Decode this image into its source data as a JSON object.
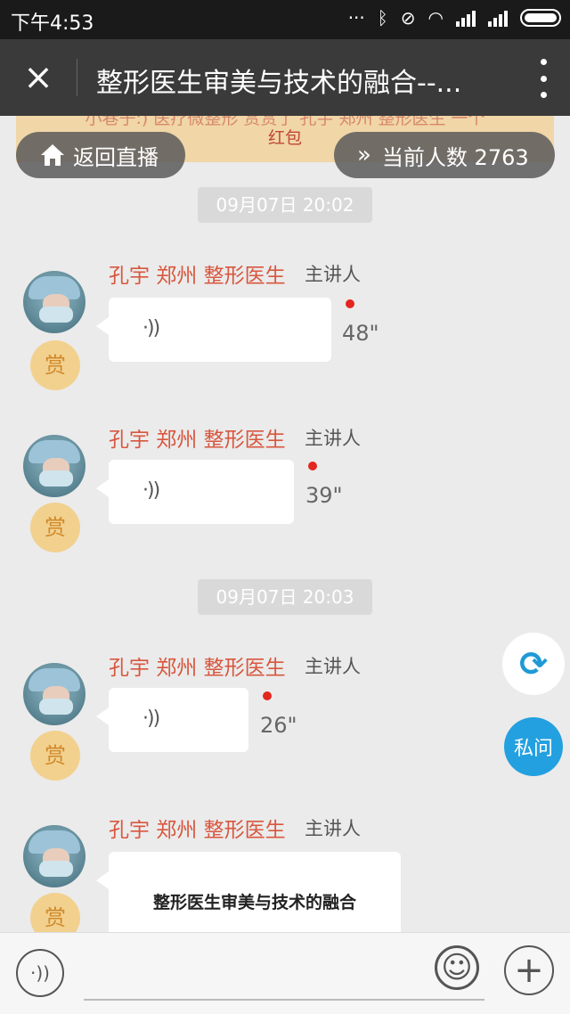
{
  "status_bar": {
    "time": "下午4:53",
    "icons": [
      "more-dots-icon",
      "bluetooth-icon",
      "vibrate-off-icon",
      "wifi-icon",
      "signal-icon",
      "signal-icon",
      "battery-icon"
    ]
  },
  "header": {
    "close_icon": "×",
    "title": "整形医生审美与技术的融合--..."
  },
  "notice": {
    "line1": "小巷子:) 医疗微整形 赏赏了 孔宇 郑州 整形医生 一个",
    "line2": "红包"
  },
  "live": {
    "back_label": "返回直播",
    "online_label": "当前人数 2763"
  },
  "messages": [
    {
      "timestamp": "09月07日 20:02"
    },
    {
      "sender": "孔宇 郑州 整形医生",
      "role": "主讲人",
      "reward": "赏",
      "type": "voice",
      "duration": "48\"",
      "unread": true
    },
    {
      "sender": "孔宇 郑州 整形医生",
      "role": "主讲人",
      "reward": "赏",
      "type": "voice",
      "duration": "39\"",
      "unread": true
    },
    {
      "timestamp": "09月07日 20:03"
    },
    {
      "sender": "孔宇 郑州 整形医生",
      "role": "主讲人",
      "reward": "赏",
      "type": "voice",
      "duration": "26\"",
      "unread": true
    },
    {
      "sender": "孔宇 郑州 整形医生",
      "role": "主讲人",
      "reward": "赏",
      "type": "document",
      "doc_title": "整形医生审美与技术的融合"
    }
  ],
  "floating": {
    "refresh_icon": "refresh-icon",
    "ask_label": "私问"
  },
  "input_bar": {
    "voice_icon": "voice-icon",
    "emoji_icon": "emoji-icon",
    "plus_icon": "plus-icon",
    "placeholder": ""
  },
  "colors": {
    "sender_name": "#d8573f",
    "accent_blue": "#23a0e0",
    "unread_dot": "#e3261e",
    "reward_bg": "#f2d18f"
  }
}
